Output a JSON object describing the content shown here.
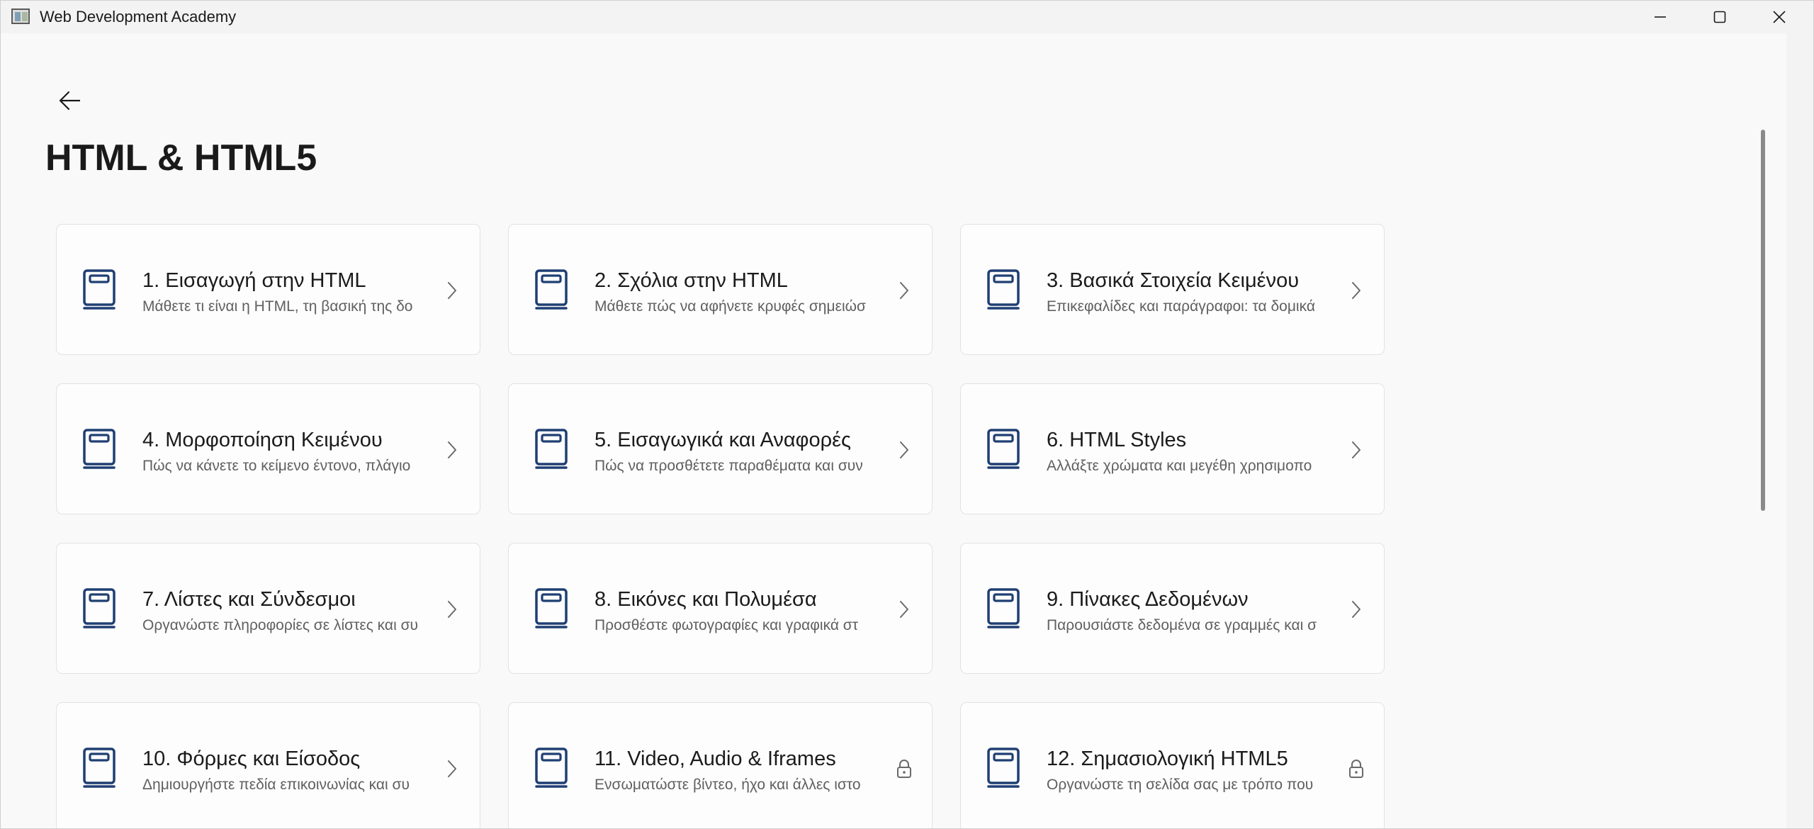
{
  "window": {
    "title": "Web Development Academy",
    "accent": "#1f3f73"
  },
  "page": {
    "title": "HTML & HTML5"
  },
  "lessons": [
    {
      "title": "1. Εισαγωγή στην HTML",
      "description": "Μάθετε τι είναι η HTML, τη βασική της δο",
      "status": "chevron-right-icon"
    },
    {
      "title": "2. Σχόλια στην HTML",
      "description": "Μάθετε πώς να αφήνετε κρυφές σημειώσ",
      "status": "chevron-right-icon"
    },
    {
      "title": "3. Βασικά Στοιχεία Κειμένου",
      "description": "Επικεφαλίδες και παράγραφοι: τα δομικά",
      "status": "chevron-right-icon"
    },
    {
      "title": "4. Μορφοποίηση Κειμένου",
      "description": "Πώς να κάνετε το κείμενο έντονο, πλάγιο",
      "status": "chevron-right-icon"
    },
    {
      "title": "5. Εισαγωγικά και Αναφορές",
      "description": "Πώς να προσθέτετε παραθέματα και συν",
      "status": "chevron-right-icon"
    },
    {
      "title": "6. HTML Styles",
      "description": "Αλλάξτε χρώματα και μεγέθη χρησιμοπο",
      "status": "chevron-right-icon"
    },
    {
      "title": "7. Λίστες και Σύνδεσμοι",
      "description": "Οργανώστε πληροφορίες σε λίστες και συ",
      "status": "chevron-right-icon"
    },
    {
      "title": "8. Εικόνες και Πολυμέσα",
      "description": "Προσθέστε φωτογραφίες και γραφικά στ",
      "status": "chevron-right-icon"
    },
    {
      "title": "9. Πίνακες Δεδομένων",
      "description": "Παρουσιάστε δεδομένα σε γραμμές και σ",
      "status": "chevron-right-icon"
    },
    {
      "title": "10. Φόρμες και Είσοδος",
      "description": "Δημιουργήστε πεδία επικοινωνίας και συ",
      "status": "chevron-right-icon"
    },
    {
      "title": "11. Video, Audio & Iframes",
      "description": "Ενσωματώστε βίντεο, ήχο και άλλες ιστο",
      "status": "lock-icon"
    },
    {
      "title": "12. Σημασιολογική HTML5",
      "description": "Οργανώστε τη σελίδα σας με τρόπο που",
      "status": "lock-icon"
    }
  ]
}
